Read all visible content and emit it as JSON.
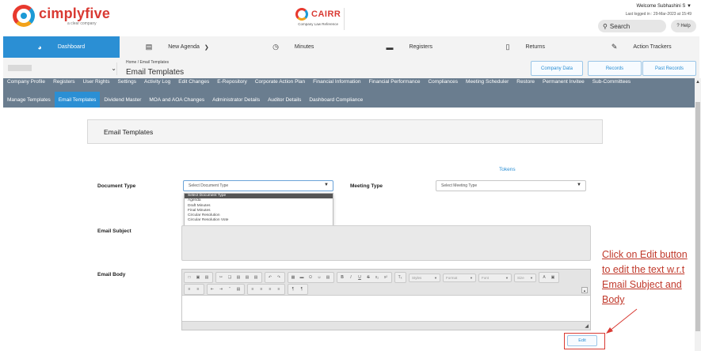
{
  "header": {
    "logo_name": "cimplyfive",
    "logo_sub": "a clear company",
    "partner_name": "CAIRR",
    "partner_sub": "Company Law Reference",
    "welcome": "Welcome Subhashini  S",
    "last_logged": "Last logged in : 29-Mar-2023 at 15:49",
    "search_placeholder": "Search",
    "help_label": "Help"
  },
  "main_nav": [
    {
      "label": "Dashboard",
      "icon": "dashboard-icon",
      "active": true
    },
    {
      "label": "New Agenda",
      "icon": "agenda-icon",
      "dropdown": true
    },
    {
      "label": "Minutes",
      "icon": "clock-icon"
    },
    {
      "label": "Registers",
      "icon": "folder-icon"
    },
    {
      "label": "Returns",
      "icon": "document-icon"
    },
    {
      "label": "Action Trackers",
      "icon": "tracker-icon"
    }
  ],
  "breadcrumb": {
    "home": "Home",
    "separator": "/",
    "current": "Email Templates",
    "title": "Email Templates"
  },
  "top_buttons": {
    "company_data": "Company Data",
    "records": "Records",
    "past_records": "Past Records"
  },
  "submenu_primary": [
    "Company Profile",
    "Registers",
    "User Rights",
    "Settings",
    "Activity Log",
    "Edit Changes",
    "E-Repository",
    "Corporate Action Plan",
    "Financial Information",
    "Financial Performance",
    "Compliances",
    "Meeting Scheduler",
    "Restore",
    "Permanent Invitee",
    "Sub-Committees"
  ],
  "submenu_secondary": [
    {
      "label": "Manage Templates"
    },
    {
      "label": "Email Templates",
      "active": true
    },
    {
      "label": "Dividend Master"
    },
    {
      "label": "MOA and AOA Changes"
    },
    {
      "label": "Administrator Details"
    },
    {
      "label": "Auditor Details"
    },
    {
      "label": "Dashboard Compliance"
    }
  ],
  "page": {
    "title": "Email Templates",
    "tokens_link": "Tokens",
    "document_type_label": "Document Type",
    "document_type_value": "Select Document Type",
    "meeting_type_label": "Meeting Type",
    "meeting_type_value": "Select Meeting Type",
    "document_type_options": [
      "Select Document Type",
      "Agenda",
      "Draft Minutes",
      "Final Minutes",
      "Circular Resolution",
      "Circular Resolution Vote"
    ],
    "email_subject_label": "Email Subject",
    "email_body_label": "Email Body",
    "edit_label": "Edit"
  },
  "editor_toolbar": {
    "styles": "Styles",
    "format": "Format",
    "font": "Font",
    "size": "Size",
    "text_color": "A"
  },
  "annotation": {
    "lines": [
      "Click on Edit button",
      "to edit the text w.r.t",
      "Email Subject and",
      "Body"
    ],
    "color": "#c0392b"
  },
  "colors": {
    "accent": "#2b8fd4",
    "submenu_bg": "#6a7d8f",
    "brand_red": "#d93a33"
  }
}
